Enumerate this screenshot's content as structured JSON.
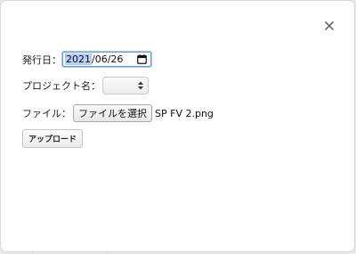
{
  "dialog": {
    "close_icon": "close-icon",
    "issue_date": {
      "label": "発行日：",
      "value_year": "2021",
      "value_rest": "/06/26",
      "icon": "calendar-icon"
    },
    "project": {
      "label": "プロジェクト名：",
      "selected": "",
      "icon": "select-arrows-icon"
    },
    "file": {
      "label": "ファイル：",
      "button_label": "ファイルを選択",
      "file_name": "SP FV 2.png"
    },
    "upload_button": "アップロード"
  }
}
